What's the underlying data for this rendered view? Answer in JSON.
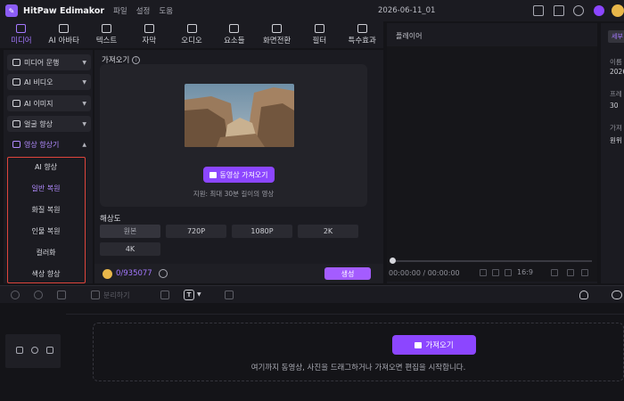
{
  "titlebar": {
    "app_name": "HitPaw Edimakor",
    "menus": [
      "파일",
      "설정",
      "도움"
    ],
    "project_name": "2026-06-11_01"
  },
  "tabs": [
    {
      "label": "미디어",
      "icon": "media-icon"
    },
    {
      "label": "AI 아바타",
      "icon": "avatar-icon"
    },
    {
      "label": "텍스트",
      "icon": "text-icon"
    },
    {
      "label": "자막",
      "icon": "subtitle-icon"
    },
    {
      "label": "오디오",
      "icon": "audio-icon"
    },
    {
      "label": "요소들",
      "icon": "elements-icon"
    },
    {
      "label": "화면전환",
      "icon": "transition-icon"
    },
    {
      "label": "필터",
      "icon": "filter-icon"
    },
    {
      "label": "특수효과",
      "icon": "effects-icon"
    }
  ],
  "sidebar": {
    "items": [
      {
        "label": "미디어 문행"
      },
      {
        "label": "AI 비디오"
      },
      {
        "label": "AI 이미지"
      },
      {
        "label": "얼굴 향상"
      },
      {
        "label": "영상 향상기"
      }
    ],
    "sub_items": [
      "AI 향상",
      "일반 복원",
      "화질 복원",
      "인물 복원",
      "컬러화",
      "색상 향상"
    ]
  },
  "import_panel": {
    "title": "가져오기",
    "import_button": "동영상 가져오기",
    "note": "지원: 최대 30분 길이의 영상",
    "resolution_label": "해상도",
    "resolutions": [
      "원본",
      "720P",
      "1080P",
      "2K",
      "4K"
    ],
    "credits": "0/935077",
    "generate_button": "생성"
  },
  "player": {
    "title": "플레이어",
    "timecode": "00:00:00 / 00:00:00",
    "aspect_ratio": "16:9"
  },
  "properties": {
    "tab_label": "세부",
    "rows": [
      "이름",
      "2026",
      "프레",
      "30",
      "가져",
      "원위"
    ]
  },
  "timeline_toolbar": {
    "split_label": "분리하기",
    "text_dropdown_glyph": "T"
  },
  "timeline": {
    "import_button": "가져오기",
    "hint": "여기까지 동영상, 사진을 드래그하거나 가져오면 편집을 시작합니다."
  },
  "colors": {
    "accent": "#8c46ff",
    "accent_text": "#a478ff",
    "highlight_border": "#e0453c"
  }
}
